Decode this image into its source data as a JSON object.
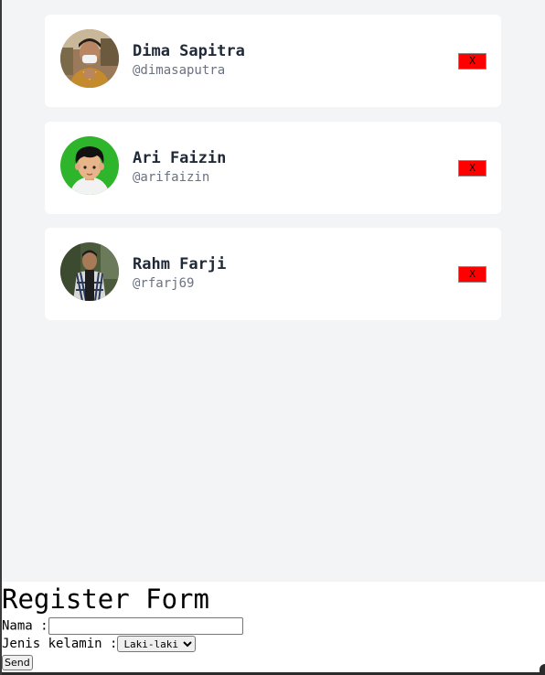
{
  "users": [
    {
      "name": "Dima Sapitra",
      "handle": "@dimasaputra",
      "avatar_icon": "person-photo-icon",
      "delete_label": "X"
    },
    {
      "name": "Ari Faizin",
      "handle": "@arifaizin",
      "avatar_icon": "cartoon-avatar-icon",
      "delete_label": "X"
    },
    {
      "name": "Rahm Farji",
      "handle": "@rfarj69",
      "avatar_icon": "person-photo-icon",
      "delete_label": "X"
    }
  ],
  "form": {
    "title": "Register Form",
    "nama_label": "Nama :",
    "nama_value": "",
    "gender_label": "Jenis kelamin :",
    "gender_selected": "Laki-laki",
    "send_label": "Send"
  },
  "colors": {
    "list_background": "#f3f4f6",
    "card_background": "#ffffff",
    "delete_button": "#ff0000"
  }
}
